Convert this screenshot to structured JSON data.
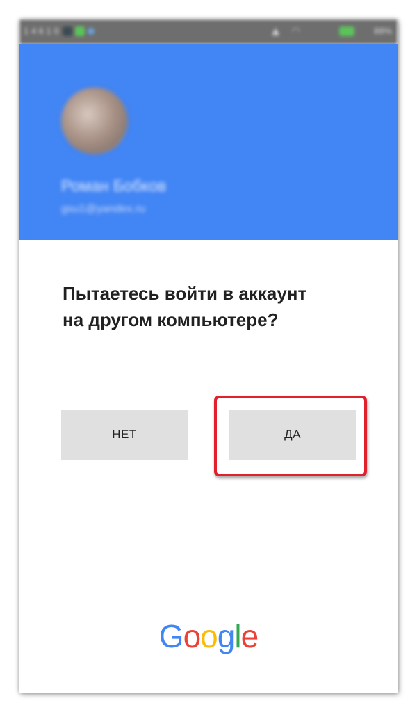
{
  "status_bar": {
    "left_text": "1 4 6 1 0",
    "right_text": "88%",
    "icons": [
      "notification-icon",
      "app-icon",
      "data-icon",
      "signal-icon",
      "wifi-icon",
      "battery-icon"
    ]
  },
  "header": {
    "background_color": "#4285f4",
    "account_name": "Роман Бобков",
    "account_email": "gsu1@yandex.ru"
  },
  "prompt": {
    "line1": "Пытаетесь войти в аккаунт",
    "line2": "на другом компьютере?"
  },
  "buttons": {
    "no_label": "НЕТ",
    "yes_label": "ДА"
  },
  "highlight": {
    "color": "#e0212b",
    "target": "yes-button"
  },
  "logo": {
    "letters": [
      {
        "char": "G",
        "color": "#4285f4"
      },
      {
        "char": "o",
        "color": "#ea4335"
      },
      {
        "char": "o",
        "color": "#fbbc05"
      },
      {
        "char": "g",
        "color": "#4285f4"
      },
      {
        "char": "l",
        "color": "#34a853"
      },
      {
        "char": "e",
        "color": "#ea4335"
      }
    ]
  }
}
